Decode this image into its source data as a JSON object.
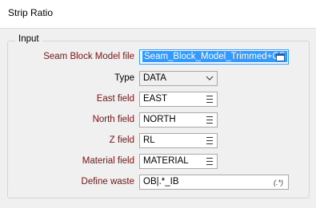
{
  "window": {
    "title": "Strip Ratio"
  },
  "group": {
    "legend": "Input"
  },
  "fields": {
    "seam_block_model_file": {
      "label": "Seam Block Model file",
      "value": "Seam_Block_Model_Trimmed+OB"
    },
    "type": {
      "label": "Type",
      "value": "DATA"
    },
    "east_field": {
      "label": "East field",
      "value": "EAST"
    },
    "north_field": {
      "label": "North field",
      "value": "NORTH"
    },
    "z_field": {
      "label": "Z field",
      "value": "RL"
    },
    "material_field": {
      "label": "Material field",
      "value": "MATERIAL"
    },
    "define_waste": {
      "label": "Define waste",
      "value": "OB|.*_IB",
      "regex_button": "(.*)"
    }
  },
  "colors": {
    "required_label": "#7a1313",
    "selection": "#3399ff",
    "accent_border": "#3399ff"
  },
  "icons": {
    "file_browse": "file-browse-icon",
    "field_list": "list-icon",
    "dropdown": "chevron-down-icon",
    "regex": "regex-icon"
  }
}
